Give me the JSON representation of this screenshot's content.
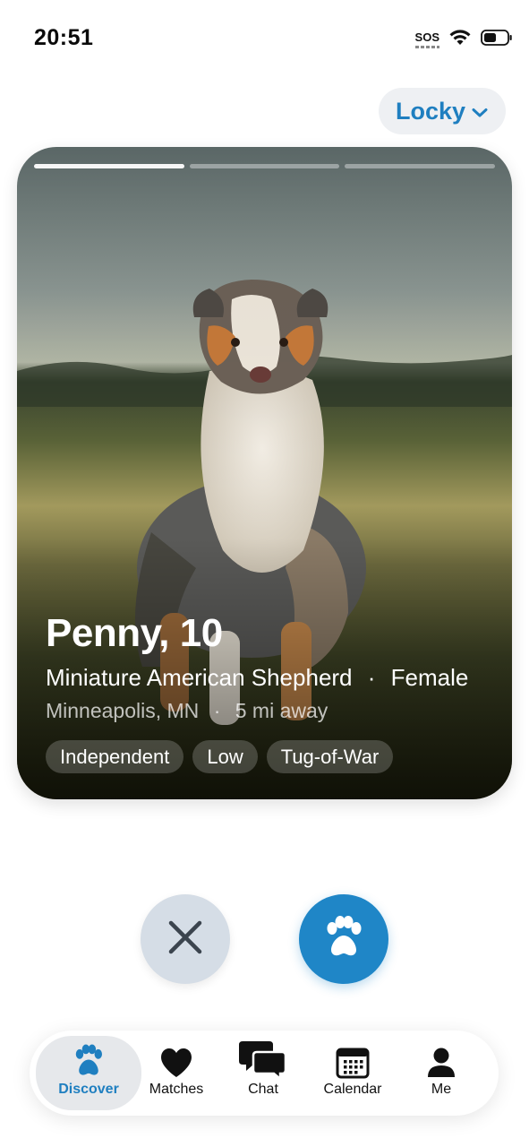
{
  "status_bar": {
    "time": "20:51",
    "sos": "SOS",
    "icons": [
      "wifi-icon",
      "battery-icon"
    ]
  },
  "pet_switcher": {
    "label": "Locky",
    "icon": "chevron-down-icon"
  },
  "card": {
    "photo": "australian-shepherd-photo",
    "photo_count": 3,
    "active_photo_index": 0,
    "name_age": "Penny, 10",
    "breed": "Miniature American Shepherd",
    "separator": "·",
    "sex": "Female",
    "location": "Minneapolis, MN",
    "distance": "5 mi away",
    "tags": [
      "Independent",
      "Low",
      "Tug-of-War"
    ]
  },
  "actions": {
    "pass_icon": "close-icon",
    "like_icon": "paw-icon"
  },
  "tabbar": {
    "items": [
      {
        "label": "Discover",
        "icon": "paw-icon",
        "active": true
      },
      {
        "label": "Matches",
        "icon": "heart-icon",
        "active": false
      },
      {
        "label": "Chat",
        "icon": "chat-bubbles-icon",
        "active": false
      },
      {
        "label": "Calendar",
        "icon": "calendar-icon",
        "active": false
      },
      {
        "label": "Me",
        "icon": "person-icon",
        "active": false
      }
    ]
  },
  "colors": {
    "accent": "#1f86c7",
    "accent_text": "#1f7fc0",
    "pass_button": "#d5dde6"
  }
}
